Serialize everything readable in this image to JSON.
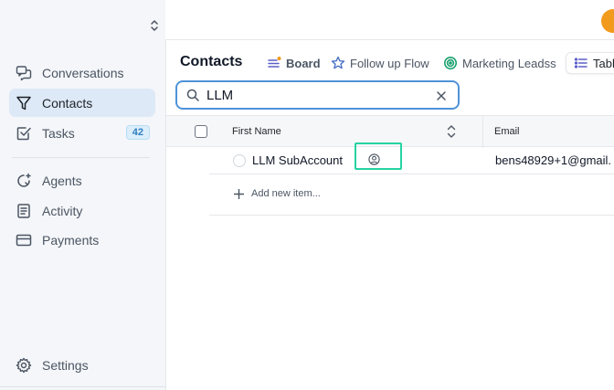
{
  "sidebar": {
    "items": [
      {
        "label": "Conversations",
        "icon": "chat-bubbles-icon"
      },
      {
        "label": "Contacts",
        "icon": "filter-funnel-icon"
      },
      {
        "label": "Tasks",
        "icon": "checkbox-icon",
        "badge": "42"
      },
      {
        "label": "Agents",
        "icon": "sparkle-agent-icon"
      },
      {
        "label": "Activity",
        "icon": "document-list-icon"
      },
      {
        "label": "Payments",
        "icon": "credit-card-icon"
      }
    ],
    "settings_label": "Settings",
    "settings_icon": "gear-icon",
    "active": "Contacts"
  },
  "header": {
    "page_title": "Contacts",
    "tabs": [
      {
        "label": "Board",
        "icon": "board-lines-icon"
      },
      {
        "label": "Follow up Flow",
        "icon": "star-icon"
      },
      {
        "label": "Marketing Leadss",
        "icon": "target-icon"
      },
      {
        "label": "Tabl",
        "icon": "list-icon"
      }
    ]
  },
  "search": {
    "value": "LLM",
    "placeholder": "",
    "clear_icon": "close-icon"
  },
  "table": {
    "columns": [
      "First Name",
      "Email"
    ],
    "rows": [
      {
        "first_name": "LLM SubAccount",
        "email": "bens48929+1@gmail."
      }
    ],
    "add_label": "Add new item..."
  },
  "colors": {
    "accent": "#4f93d8",
    "active_nav": "#dde9f7",
    "highlight": "#26d3a2",
    "badge_text": "#2f7fc1",
    "avatar": "#f29a1c"
  }
}
